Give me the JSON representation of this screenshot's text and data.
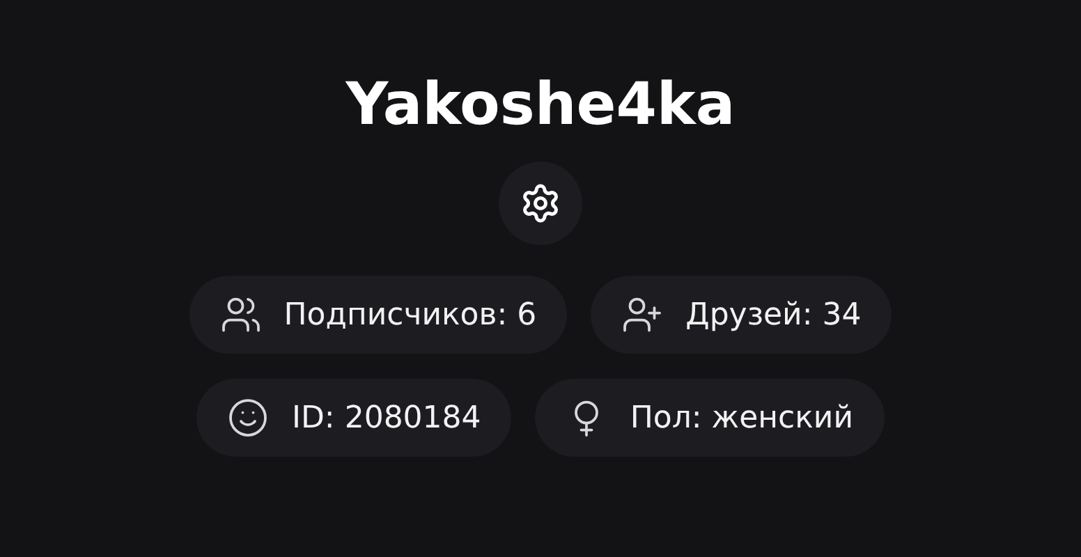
{
  "profile": {
    "username": "Yakoshe4ka"
  },
  "stats": [
    [
      {
        "kind": "followers",
        "text": "Подписчиков: 6"
      },
      {
        "kind": "friends",
        "text": "Друзей: 34"
      }
    ],
    [
      {
        "kind": "id",
        "text": "ID: 2080184"
      },
      {
        "kind": "gender",
        "text": "Пол: женский"
      }
    ]
  ]
}
